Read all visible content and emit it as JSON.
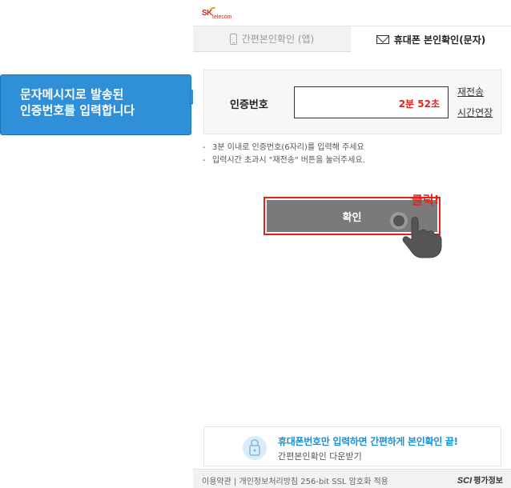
{
  "callout": {
    "line1": "문자메시지로 발송된",
    "line2": "인증번호를 입력합니다"
  },
  "header": {
    "logo_mark": "SK",
    "logo_text": "telecom"
  },
  "tabs": [
    {
      "label": "간편본인확인 (앱)",
      "icon": "phone-icon",
      "active": false
    },
    {
      "label": "휴대폰 본인확인(문자)",
      "icon": "mail-icon",
      "active": true
    }
  ],
  "verification": {
    "label": "인증번호",
    "value": "",
    "timer": "2분 52초",
    "resend_label": "재전송",
    "extend_label": "시간연장"
  },
  "notes": [
    "3분 이내로 인증번호(6자리)를 입력해 주세요",
    "입력시간 초과시 \"재전송\" 버튼을 눌러주세요."
  ],
  "confirm": {
    "label": "확인",
    "click_hint": "클릭!"
  },
  "promo": {
    "title": "휴대폰번호만 입력하면 간편하게 본인확인 끝!",
    "subtitle": "간편본인확인 다운받기"
  },
  "footer": {
    "links": "이용약관 | 개인정보처리방침 256-bit SSL 암호화 적용",
    "brand_mark": "SCI",
    "brand_text": "평가정보"
  },
  "colors": {
    "accent_red": "#e2231a",
    "callout_blue": "#2f8fd8",
    "promo_blue": "#1a8fd6",
    "button_gray": "#7a7a7a"
  }
}
